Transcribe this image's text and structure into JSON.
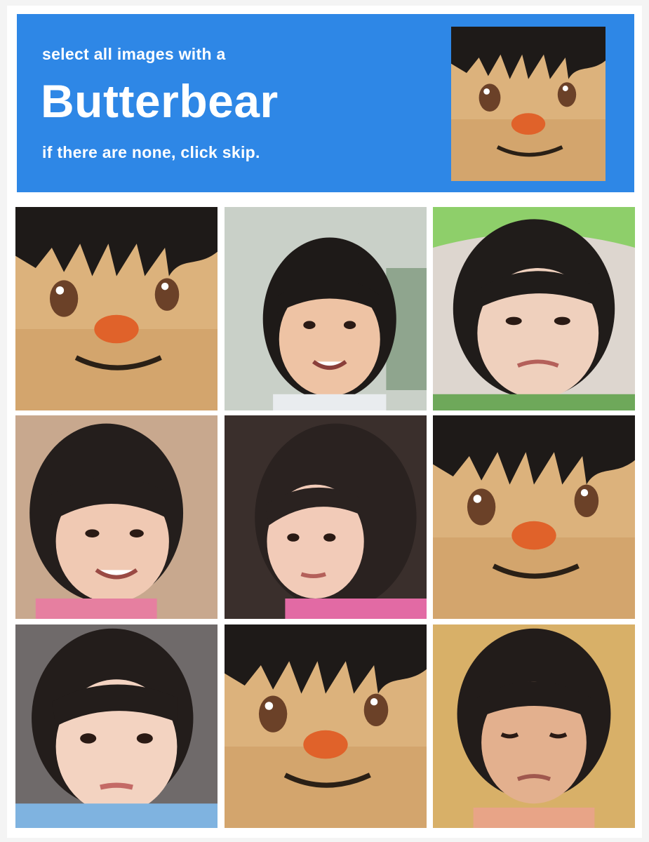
{
  "challenge": {
    "prompt_top": "select all images with a",
    "keyword": "Butterbear",
    "prompt_bottom": "if there are none, click skip."
  },
  "sample_image": {
    "content": "butterbear-plush-face"
  },
  "grid": {
    "tiles": [
      {
        "content": "butterbear-plush-face"
      },
      {
        "content": "child-photo-smiling"
      },
      {
        "content": "child-photo-green-hat"
      },
      {
        "content": "child-photo-smiling"
      },
      {
        "content": "child-photo-blurred"
      },
      {
        "content": "butterbear-plush-face"
      },
      {
        "content": "child-photo"
      },
      {
        "content": "butterbear-plush-face"
      },
      {
        "content": "child-photo-frowning"
      }
    ]
  },
  "colors": {
    "header_bg": "#2e87e6",
    "header_text": "#ffffff",
    "plush_fur": "#dcb27c",
    "plush_nose": "#e0622a",
    "hair": "#1e1a18"
  }
}
